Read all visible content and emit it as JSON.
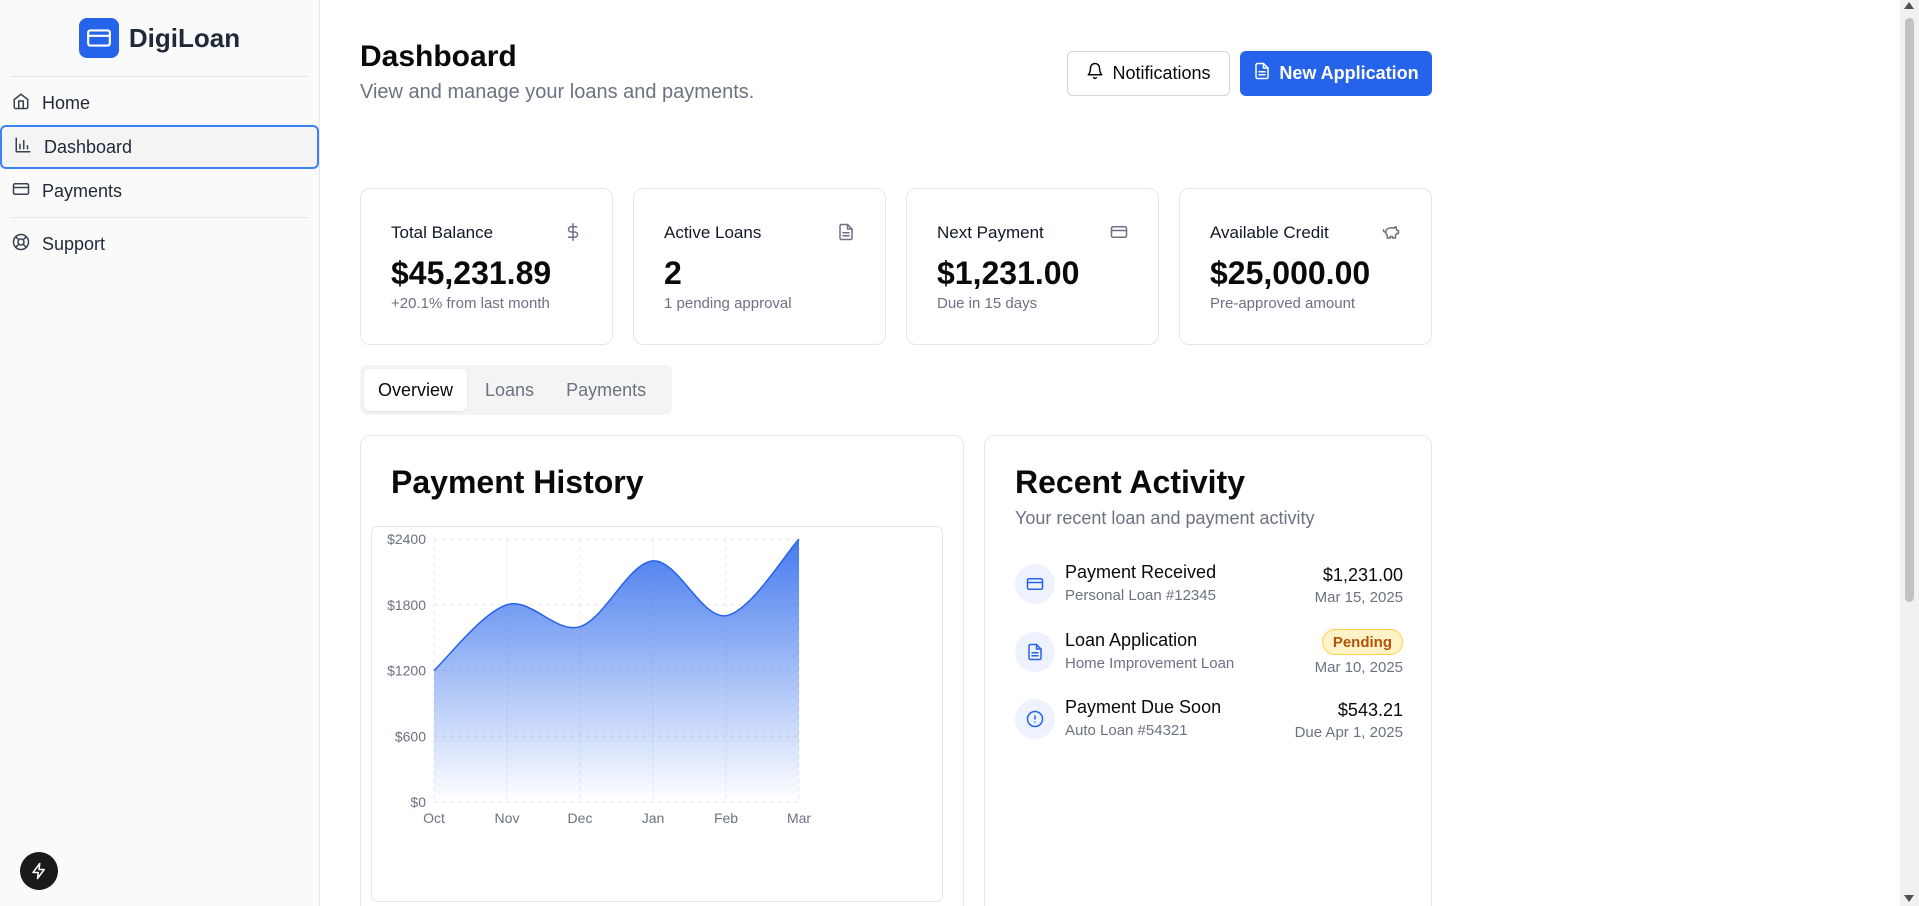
{
  "brand": {
    "name": "DigiLoan",
    "logo_icon": "credit-card-icon",
    "accent": "#2563eb"
  },
  "sidebar": {
    "items": [
      {
        "label": "Home",
        "icon": "home-icon"
      },
      {
        "label": "Dashboard",
        "icon": "bar-chart-icon",
        "active": true
      },
      {
        "label": "Payments",
        "icon": "credit-card-icon"
      },
      {
        "label": "Support",
        "icon": "lifebuoy-icon"
      }
    ]
  },
  "header": {
    "title": "Dashboard",
    "subtitle": "View and manage your loans and payments.",
    "notifications_label": "Notifications",
    "new_application_label": "New Application"
  },
  "stats": [
    {
      "label": "Total Balance",
      "value": "$45,231.89",
      "note": "+20.1% from last month",
      "icon": "dollar-icon"
    },
    {
      "label": "Active Loans",
      "value": "2",
      "note": "1 pending approval",
      "icon": "document-icon"
    },
    {
      "label": "Next Payment",
      "value": "$1,231.00",
      "note": "Due in 15 days",
      "icon": "credit-card-icon"
    },
    {
      "label": "Available Credit",
      "value": "$25,000.00",
      "note": "Pre-approved amount",
      "icon": "piggy-bank-icon"
    }
  ],
  "tabs": [
    {
      "label": "Overview",
      "active": true
    },
    {
      "label": "Loans"
    },
    {
      "label": "Payments"
    }
  ],
  "payment_history": {
    "title": "Payment History"
  },
  "chart_data": {
    "type": "area",
    "title": "Payment History",
    "categories": [
      "Oct",
      "Nov",
      "Dec",
      "Jan",
      "Feb",
      "Mar"
    ],
    "values": [
      1200,
      1800,
      1600,
      2200,
      1700,
      2400
    ],
    "y_ticks": [
      "$0",
      "$600",
      "$1200",
      "$1800",
      "$2400"
    ],
    "ylim": [
      0,
      2400
    ],
    "grid": true,
    "color": "#2563eb"
  },
  "recent_activity": {
    "title": "Recent Activity",
    "description": "Your recent loan and payment activity",
    "items": [
      {
        "title": "Payment Received",
        "subtitle": "Personal Loan #12345",
        "amount": "$1,231.00",
        "date": "Mar 15, 2025",
        "icon": "credit-card-icon"
      },
      {
        "title": "Loan Application",
        "subtitle": "Home Improvement Loan",
        "badge": "Pending",
        "date": "Mar 10, 2025",
        "icon": "document-icon"
      },
      {
        "title": "Payment Due Soon",
        "subtitle": "Auto Loan #54321",
        "amount": "$543.21",
        "date": "Due Apr 1, 2025",
        "icon": "alert-circle-icon"
      }
    ]
  }
}
